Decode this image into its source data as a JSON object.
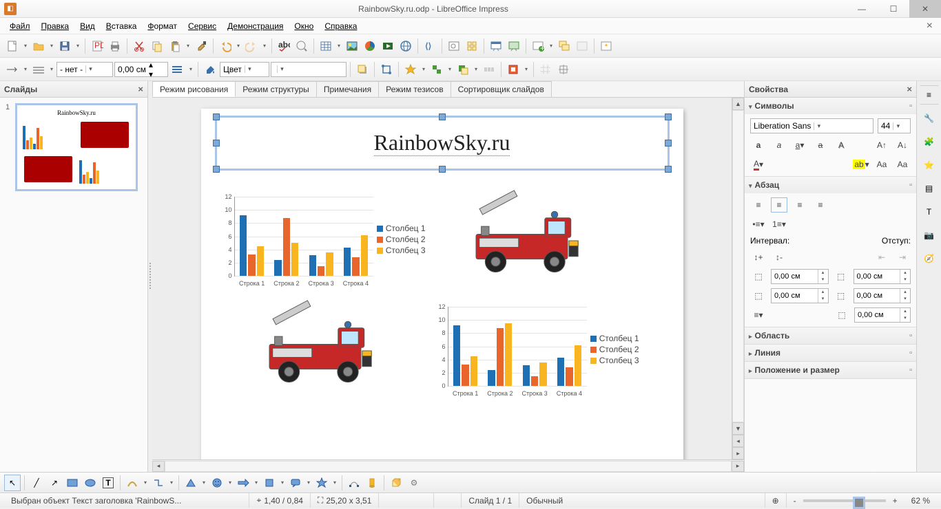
{
  "window": {
    "title": "RainbowSky.ru.odp - LibreOffice Impress"
  },
  "menu": {
    "file": "Файл",
    "edit": "Правка",
    "view": "Вид",
    "insert": "Вставка",
    "format": "Формат",
    "tools": "Сервис",
    "slideshow": "Демонстрация",
    "window": "Окно",
    "help": "Справка"
  },
  "toolbar2": {
    "linestyle": "- нет -",
    "linewidth": "0,00 см",
    "fillmode": "Цвет",
    "fillcolor": "#729fcf"
  },
  "slidespanel": {
    "title": "Слайды",
    "num": "1"
  },
  "viewtabs": [
    "Режим рисования",
    "Режим структуры",
    "Примечания",
    "Режим тезисов",
    "Сортировщик слайдов"
  ],
  "slide": {
    "title": "RainbowSky.ru"
  },
  "chart_data": [
    {
      "type": "bar",
      "categories": [
        "Строка 1",
        "Строка 2",
        "Строка 3",
        "Строка 4"
      ],
      "series": [
        {
          "name": "Столбец 1",
          "color": "#1f6fb5",
          "values": [
            9.2,
            2.4,
            3.1,
            4.3
          ]
        },
        {
          "name": "Столбец 2",
          "color": "#e8662c",
          "values": [
            3.2,
            8.8,
            1.5,
            2.8
          ]
        },
        {
          "name": "Столбец 3",
          "color": "#f8b520",
          "values": [
            4.5,
            5.0,
            3.5,
            6.2
          ]
        }
      ],
      "ylim": [
        0,
        12
      ],
      "yticks": [
        0,
        2,
        4,
        6,
        8,
        10,
        12
      ]
    },
    {
      "type": "bar",
      "categories": [
        "Строка 1",
        "Строка 2",
        "Строка 3",
        "Строка 4"
      ],
      "series": [
        {
          "name": "Столбец 1",
          "color": "#1f6fb5",
          "values": [
            9.2,
            2.4,
            3.1,
            4.3
          ]
        },
        {
          "name": "Столбец 2",
          "color": "#e8662c",
          "values": [
            3.2,
            8.8,
            1.5,
            2.8
          ]
        },
        {
          "name": "Столбец 3",
          "color": "#f8b520",
          "values": [
            4.5,
            9.5,
            3.5,
            6.2
          ]
        }
      ],
      "ylim": [
        0,
        12
      ],
      "yticks": [
        0,
        2,
        4,
        6,
        8,
        10,
        12
      ]
    }
  ],
  "properties": {
    "title": "Свойства",
    "symbols": "Символы",
    "font": "Liberation Sans",
    "fontsize": "44",
    "para": "Абзац",
    "interval": "Интервал:",
    "indent": "Отступ:",
    "spin": "0,00 см",
    "area": "Область",
    "line": "Линия",
    "pos": "Положение и размер"
  },
  "status": {
    "selection": "Выбран объект Текст заголовка 'RainbowS...",
    "pos": "1,40 / 0,84",
    "size": "25,20 x 3,51",
    "slide": "Слайд 1 / 1",
    "style": "Обычный",
    "zoom": "62 %"
  }
}
